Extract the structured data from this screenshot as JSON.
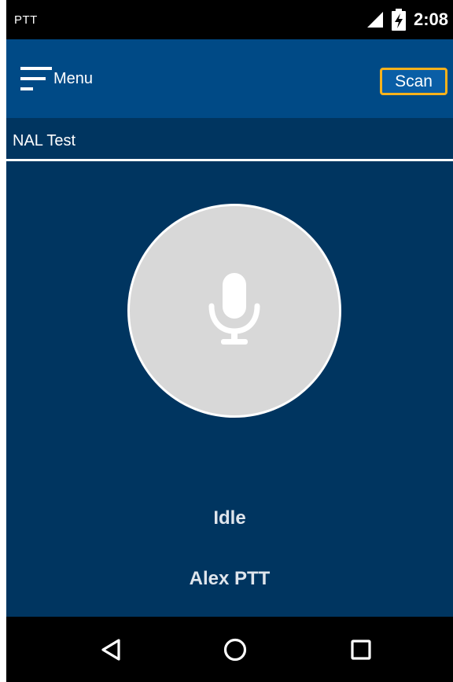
{
  "status_bar": {
    "app_name": "PTT",
    "time": "2:08",
    "icons": [
      "signal-icon",
      "battery-charging-icon"
    ]
  },
  "app_bar": {
    "menu_label": "Menu",
    "menu_icon": "hamburger-menu-icon",
    "scan_label": "Scan"
  },
  "channel": {
    "name": "NAL Test"
  },
  "ptt": {
    "icon": "microphone-icon",
    "status": "Idle",
    "user": "Alex PTT"
  },
  "nav_bar": {
    "icons": [
      "back-icon",
      "home-icon",
      "recents-icon"
    ]
  },
  "colors": {
    "background": "#003560",
    "app_bar": "#004a86",
    "scan_border": "#f7b21b",
    "ptt_button": "#d8d8d8"
  }
}
